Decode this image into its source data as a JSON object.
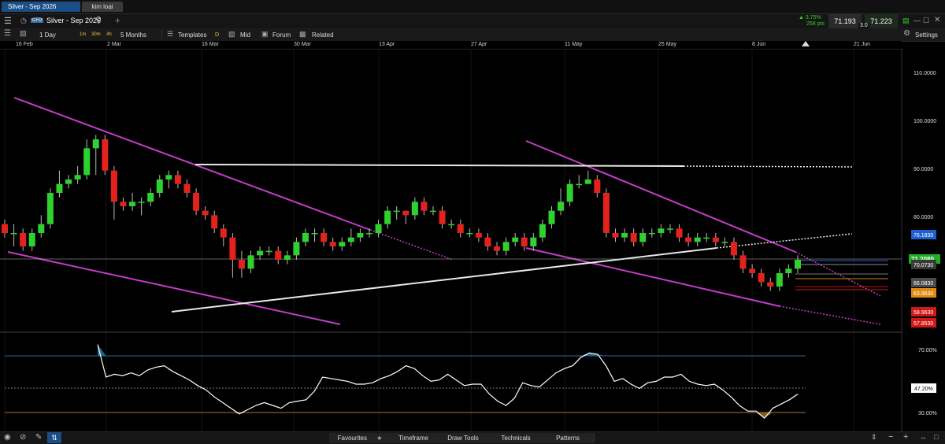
{
  "tabs": [
    {
      "label": "Silver - Sep 2026",
      "active": true
    },
    {
      "label": "kim loại",
      "active": false
    }
  ],
  "instrument": {
    "badge": "CFD",
    "name": "Silver - Sep 2026"
  },
  "quote": {
    "change_pct": "▲ 3.75%",
    "change_pts": "258 pts",
    "sell": "71.193",
    "buy": "71.223",
    "spread": "3.0"
  },
  "toolbar": {
    "timeframe": "1 Day",
    "intervals": [
      "1m",
      "30m",
      "4h"
    ],
    "range": "5 Months",
    "templates": "Templates",
    "d_label": "D",
    "mid": "Mid",
    "forum": "Forum",
    "related": "Related",
    "settings": "Settings"
  },
  "bottom": {
    "favourites": "Favourites",
    "timeframe": "Timeframe",
    "draw_tools": "Draw Tools",
    "technicals": "Technicals",
    "patterns": "Patterns"
  },
  "colors": {
    "up": "#2ed12e",
    "down": "#e3221c",
    "channel": "#c43cc8",
    "trend": "#e8e8e8",
    "rsi": "#ffffff"
  },
  "chart_data": [
    {
      "type": "candlestick",
      "title": "",
      "x_ticks": [
        "16 Feb",
        "2 Mar",
        "16 Mar",
        "30 Mar",
        "13 Apr",
        "27 Apr",
        "11 May",
        "25 May",
        "8 Jun",
        "21 Jun"
      ],
      "y_ticks": [
        "110.0000",
        "100.0000",
        "90.0000",
        "80.0000"
      ],
      "ylim": [
        56,
        113
      ],
      "candles": [
        [
          79,
          77,
          80,
          76
        ],
        [
          77,
          77,
          79,
          74
        ],
        [
          77,
          74,
          78,
          73
        ],
        [
          74,
          77,
          78,
          73
        ],
        [
          77,
          79,
          81,
          76
        ],
        [
          79,
          86,
          87,
          78
        ],
        [
          86,
          88,
          91,
          85
        ],
        [
          88,
          89,
          90,
          87
        ],
        [
          89,
          90,
          92,
          88
        ],
        [
          90,
          96,
          98,
          89
        ],
        [
          96,
          98,
          99,
          90
        ],
        [
          98,
          91,
          99,
          90
        ],
        [
          91,
          84,
          92,
          80
        ],
        [
          84,
          83,
          85,
          82
        ],
        [
          83,
          84,
          86,
          82
        ],
        [
          84,
          84,
          85,
          81
        ],
        [
          84,
          86,
          87,
          83
        ],
        [
          86,
          89,
          90,
          85
        ],
        [
          89,
          90,
          91,
          87
        ],
        [
          90,
          88,
          91,
          87
        ],
        [
          88,
          86,
          89,
          85
        ],
        [
          86,
          82,
          87,
          81
        ],
        [
          82,
          81,
          83,
          80
        ],
        [
          81,
          78,
          82,
          77
        ],
        [
          78,
          76,
          79,
          74
        ],
        [
          76,
          71,
          77,
          67
        ],
        [
          71,
          69,
          73,
          67
        ],
        [
          69,
          72,
          73,
          68
        ],
        [
          72,
          73,
          74,
          71
        ],
        [
          73,
          73,
          74,
          72
        ],
        [
          73,
          71,
          74,
          70
        ],
        [
          71,
          72,
          73,
          70
        ],
        [
          72,
          75,
          76,
          71
        ],
        [
          75,
          77,
          78,
          74
        ],
        [
          77,
          77,
          78,
          75
        ],
        [
          77,
          75,
          78,
          74
        ],
        [
          75,
          74,
          76,
          73
        ],
        [
          74,
          75,
          76,
          73
        ],
        [
          75,
          76,
          78,
          74
        ],
        [
          76,
          77,
          78,
          75
        ],
        [
          77,
          77,
          78,
          76
        ],
        [
          77,
          79,
          80,
          76
        ],
        [
          79,
          82,
          83,
          78
        ],
        [
          82,
          82,
          83,
          80
        ],
        [
          82,
          81,
          82,
          79
        ],
        [
          81,
          84,
          85,
          80
        ],
        [
          84,
          82,
          85,
          81
        ],
        [
          82,
          82,
          83,
          81
        ],
        [
          82,
          79,
          83,
          78
        ],
        [
          79,
          79,
          80,
          78
        ],
        [
          79,
          77,
          80,
          76
        ],
        [
          77,
          77,
          78,
          76
        ],
        [
          77,
          76,
          78,
          75
        ],
        [
          76,
          74,
          77,
          73
        ],
        [
          74,
          73,
          75,
          72
        ],
        [
          73,
          75,
          76,
          72
        ],
        [
          75,
          76,
          77,
          74
        ],
        [
          76,
          74,
          77,
          73
        ],
        [
          74,
          76,
          77,
          73
        ],
        [
          76,
          79,
          80,
          75
        ],
        [
          79,
          82,
          83,
          78
        ],
        [
          82,
          84,
          87,
          81
        ],
        [
          84,
          88,
          89,
          83
        ],
        [
          88,
          88,
          90,
          87
        ],
        [
          88,
          89,
          91,
          88
        ],
        [
          89,
          86,
          90,
          85
        ],
        [
          86,
          77,
          87,
          76
        ],
        [
          77,
          76,
          78,
          75
        ],
        [
          76,
          77,
          78,
          75
        ],
        [
          77,
          75,
          78,
          74
        ],
        [
          75,
          77,
          78,
          74
        ],
        [
          77,
          77,
          78,
          76
        ],
        [
          77,
          78,
          79,
          76
        ],
        [
          78,
          78,
          79,
          77
        ],
        [
          78,
          76,
          79,
          75
        ],
        [
          76,
          75,
          77,
          74
        ],
        [
          75,
          76,
          77,
          74
        ],
        [
          76,
          76,
          77,
          75
        ],
        [
          76,
          75,
          77,
          74
        ],
        [
          75,
          75,
          76,
          74
        ],
        [
          75,
          72,
          76,
          71
        ],
        [
          72,
          69,
          73,
          68
        ],
        [
          69,
          68,
          70,
          67
        ],
        [
          68,
          66,
          69,
          65
        ],
        [
          66,
          65,
          67,
          64
        ],
        [
          65,
          68,
          69,
          64
        ],
        [
          68,
          69,
          70,
          67
        ],
        [
          69,
          71,
          72,
          68
        ]
      ],
      "price_labels": [
        {
          "value": "76.1830",
          "color": "#1e5fd2"
        },
        {
          "value": "71.2080",
          "color": "#22b022"
        },
        {
          "value": "70.0730",
          "color": "#3a3a3a"
        },
        {
          "value": "66.0830",
          "color": "#4a4a4a"
        },
        {
          "value": "63.9630",
          "color": "#e08a10"
        },
        {
          "value": "59.9630",
          "color": "#d01818"
        },
        {
          "value": "57.8530",
          "color": "#d01818"
        }
      ]
    },
    {
      "type": "line",
      "title": "",
      "y_ticks": [
        "70.00%",
        "30.00%"
      ],
      "current_label": "47.20%",
      "ylim": [
        20,
        80
      ],
      "levels": [
        70,
        47.2,
        30
      ],
      "values": [
        78,
        55,
        57,
        56,
        58,
        56,
        60,
        62,
        63,
        59,
        56,
        53,
        49,
        46,
        41,
        37,
        33,
        29,
        32,
        35,
        37,
        35,
        33,
        37,
        38,
        39,
        45,
        55,
        54,
        53,
        52,
        50,
        50,
        51,
        54,
        56,
        59,
        63,
        61,
        56,
        52,
        53,
        57,
        53,
        49,
        50,
        50,
        43,
        38,
        35,
        40,
        51,
        49,
        48,
        53,
        58,
        61,
        63,
        69,
        72,
        71,
        63,
        52,
        54,
        50,
        47,
        51,
        52,
        55,
        55,
        57,
        52,
        50,
        49,
        50,
        46,
        41,
        35,
        31,
        31,
        26,
        33,
        36,
        39,
        43
      ]
    }
  ]
}
